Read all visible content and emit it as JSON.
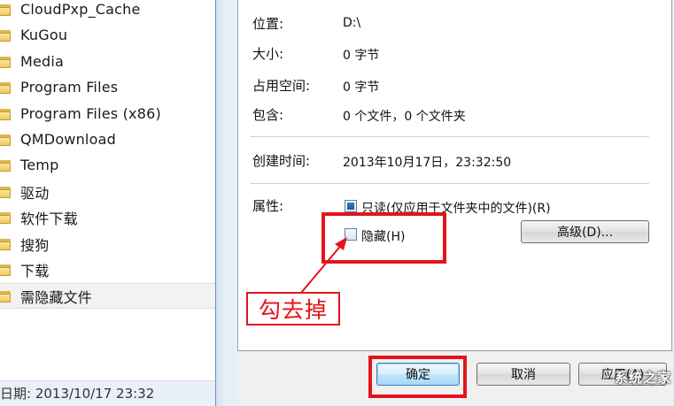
{
  "explorer": {
    "folders": [
      {
        "label": "CloudPxp_Cache",
        "selected": false
      },
      {
        "label": "KuGou",
        "selected": false
      },
      {
        "label": "Media",
        "selected": false
      },
      {
        "label": "Program Files",
        "selected": false
      },
      {
        "label": "Program Files (x86)",
        "selected": false
      },
      {
        "label": "QMDownload",
        "selected": false
      },
      {
        "label": "Temp",
        "selected": false
      },
      {
        "label": "驱动",
        "selected": false
      },
      {
        "label": "软件下载",
        "selected": false
      },
      {
        "label": "搜狗",
        "selected": false
      },
      {
        "label": "下载",
        "selected": false
      },
      {
        "label": "需隐藏文件",
        "selected": true
      }
    ],
    "modified_text": "日期: 2013/10/17 23:32"
  },
  "dialog": {
    "properties": {
      "location_label": "位置:",
      "location_value": "D:\\",
      "size_label": "大小:",
      "size_value": "0 字节",
      "disk_size_label": "占用空间:",
      "disk_size_value": "0 字节",
      "contains_label": "包含:",
      "contains_value": "0 个文件，0 个文件夹",
      "created_label": "创建时间:",
      "created_value": "2013年10月17日，23:32:50",
      "attributes_label": "属性:"
    },
    "attributes": {
      "readonly_label": "只读(仅应用于文件夹中的文件)(R)",
      "readonly_checked": true,
      "hidden_label": "隐藏(H)",
      "hidden_checked": false,
      "advanced_button": "高级(D)..."
    },
    "footer": {
      "ok_button": "确定",
      "cancel_button": "取消",
      "apply_button": "应用(A)"
    }
  },
  "annotation": {
    "text": "勾去掉",
    "color": "#e3141b"
  },
  "watermark": {
    "text": "系统之家"
  }
}
